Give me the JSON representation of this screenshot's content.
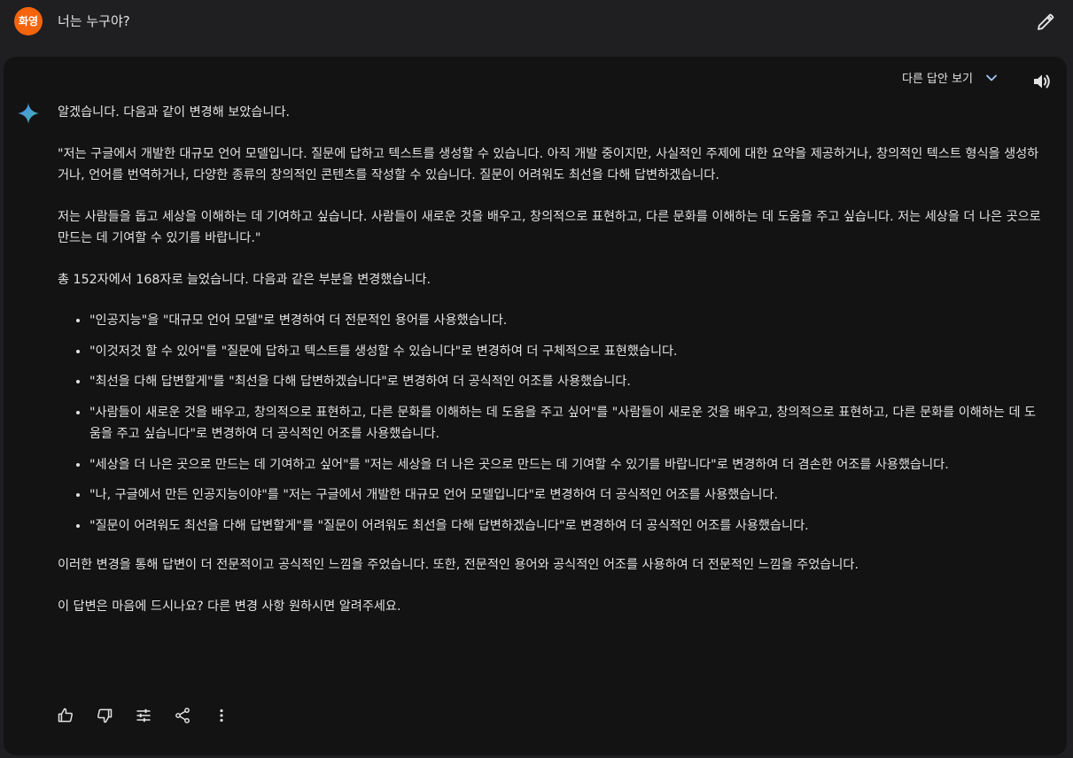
{
  "user": {
    "avatar_text": "화영",
    "avatar_color": "#f4640c",
    "query": "너는 누구야?",
    "edit_icon": "pencil-icon"
  },
  "response": {
    "other_answers_label": "다른 답안 보기",
    "chevron_icon": "chevron-down-icon",
    "speaker_icon": "speaker-icon",
    "assistant_icon": "sparkle-icon",
    "intro": "알겠습니다. 다음과 같이 변경해 보았습니다.",
    "quote_p1": "\"저는 구글에서 개발한 대규모 언어 모델입니다. 질문에 답하고 텍스트를 생성할 수 있습니다. 아직 개발 중이지만, 사실적인 주제에 대한 요약을 제공하거나, 창의적인 텍스트 형식을 생성하거나, 언어를 번역하거나, 다양한 종류의 창의적인 콘텐츠를 작성할 수 있습니다. 질문이 어려워도 최선을 다해 답변하겠습니다.",
    "quote_p2": "저는 사람들을 돕고 세상을 이해하는 데 기여하고 싶습니다. 사람들이 새로운 것을 배우고, 창의적으로 표현하고, 다른 문화를 이해하는 데 도움을 주고 싶습니다. 저는 세상을 더 나은 곳으로 만드는 데 기여할 수 있기를 바랍니다.\"",
    "count_summary": "총 152자에서 168자로 늘었습니다. 다음과 같은 부분을 변경했습니다.",
    "changes": [
      "\"인공지능\"을 \"대규모 언어 모델\"로 변경하여 더 전문적인 용어를 사용했습니다.",
      "\"이것저것 할 수 있어\"를 \"질문에 답하고 텍스트를 생성할 수 있습니다\"로 변경하여 더 구체적으로 표현했습니다.",
      "\"최선을 다해 답변할게\"를 \"최선을 다해 답변하겠습니다\"로 변경하여 더 공식적인 어조를 사용했습니다.",
      "\"사람들이 새로운 것을 배우고, 창의적으로 표현하고, 다른 문화를 이해하는 데 도움을 주고 싶어\"를 \"사람들이 새로운 것을 배우고, 창의적으로 표현하고, 다른 문화를 이해하는 데 도움을 주고 싶습니다\"로 변경하여 더 공식적인 어조를 사용했습니다.",
      "\"세상을 더 나은 곳으로 만드는 데 기여하고 싶어\"를 \"저는 세상을 더 나은 곳으로 만드는 데 기여할 수 있기를 바랍니다\"로 변경하여 더 겸손한 어조를 사용했습니다.",
      "\"나, 구글에서 만든 인공지능이야\"를 \"저는 구글에서 개발한 대규모 언어 모델입니다\"로 변경하여 더 공식적인 어조를 사용했습니다.",
      "\"질문이 어려워도 최선을 다해 답변할게\"를 \"질문이 어려워도 최선을 다해 답변하겠습니다\"로 변경하여 더 공식적인 어조를 사용했습니다."
    ],
    "conclusion": "이러한 변경을 통해 답변이 더 전문적이고 공식적인 느낌을 주었습니다. 또한, 전문적인 용어와 공식적인 어조를 사용하여 더 전문적인 느낌을 주었습니다.",
    "closing_question": "이 답변은 마음에 드시나요? 다른 변경 사항 원하시면 알려주세요."
  },
  "actions": {
    "icons": [
      "thumbs-up-icon",
      "thumbs-down-icon",
      "tune-icon",
      "share-icon",
      "more-vert-icon"
    ]
  },
  "colors": {
    "page_bg": "#1f1f22",
    "card_bg": "#131314",
    "text": "#e3e3e3",
    "avatar": "#f4640c",
    "sparkle_blue": "#4e8cf0",
    "sparkle_teal": "#3fb7a8"
  }
}
